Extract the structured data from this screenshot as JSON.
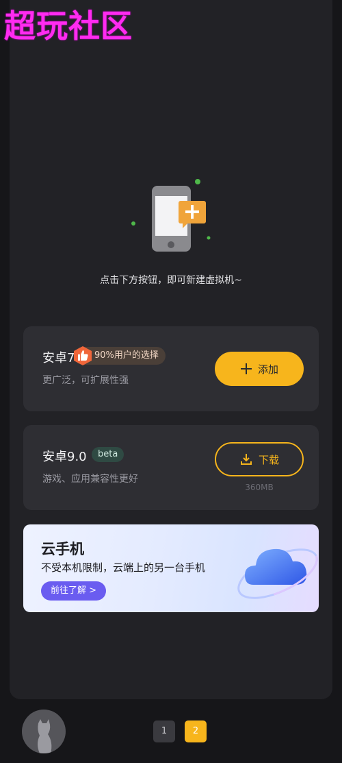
{
  "watermark": "超玩社区",
  "hint": "点击下方按钮，即可新建虚拟机~",
  "android7": {
    "title": "安卓7.1.2",
    "badge": "90%用户的选择",
    "subtitle": "更广泛，可扩展性强",
    "button": "添加"
  },
  "android9": {
    "title": "安卓9.0",
    "beta": "beta",
    "subtitle": "游戏、应用兼容性更好",
    "button": "下载",
    "size": "360MB"
  },
  "banner": {
    "title": "云手机",
    "subtitle": "不受本机限制，云端上的另一台手机",
    "button": "前往了解 >"
  },
  "pager": [
    "1",
    "2"
  ],
  "colors": {
    "accent": "#f7b51c",
    "watermark": "#ff2bf0",
    "banner_button": "#6a5cf0"
  }
}
